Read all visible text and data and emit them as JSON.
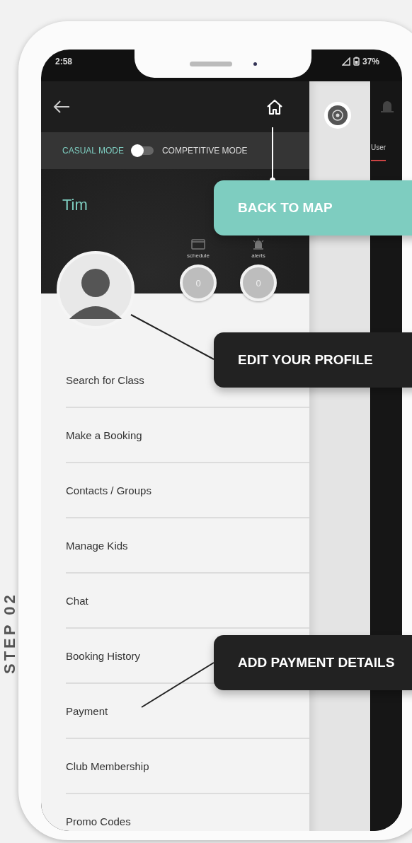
{
  "step_label": "STEP 02",
  "status_bar": {
    "time": "2:58",
    "battery": "37%"
  },
  "mode_switch": {
    "left_label": "CASUAL MODE",
    "right_label": "COMPETITIVE MODE",
    "on": false
  },
  "profile": {
    "name": "Tim"
  },
  "counters": [
    {
      "kind": "schedule",
      "label": "schedule",
      "value": "0"
    },
    {
      "kind": "alerts",
      "label": "alerts",
      "value": "0"
    }
  ],
  "menu": [
    "Search for Class",
    "Make a Booking",
    "Contacts / Groups",
    "Manage Kids",
    "Chat",
    "Booking History",
    "Payment",
    "Club Membership",
    "Promo Codes"
  ],
  "map_panel": {
    "tab": "User"
  },
  "callouts": [
    {
      "text": "BACK TO MAP",
      "color": "#7ecdc0"
    },
    {
      "text": "EDIT YOUR PROFILE",
      "color": "#222222"
    },
    {
      "text": "ADD PAYMENT DETAILS",
      "color": "#222222"
    }
  ]
}
